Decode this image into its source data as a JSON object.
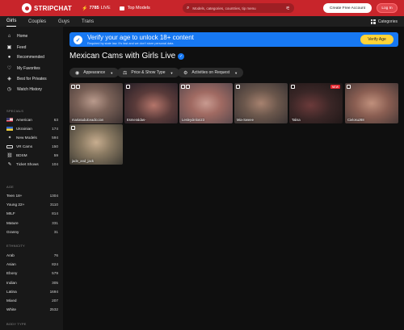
{
  "header": {
    "logo_text": "STRIPCHAT",
    "live_count": "7785",
    "live_label": "LIVE",
    "top_models_label": "Top Models",
    "search_placeholder": "Models, categories, countries, tip menu",
    "create_account_label": "Create Free Account",
    "login_label": "Log In",
    "colors": {
      "brand": "#c8252b",
      "accent": "#1778f2",
      "verify": "#ffd338"
    }
  },
  "tabs": [
    {
      "label": "Girls",
      "active": true
    },
    {
      "label": "Couples",
      "active": false
    },
    {
      "label": "Guys",
      "active": false
    },
    {
      "label": "Trans",
      "active": false
    }
  ],
  "categories_label": "Categories",
  "sidebar": {
    "nav": [
      {
        "label": "Home",
        "icon": "home-icon"
      },
      {
        "label": "Feed",
        "icon": "feed-icon"
      },
      {
        "label": "Recommended",
        "icon": "recommended-icon"
      },
      {
        "label": "My Favorites",
        "icon": "heart-icon"
      },
      {
        "label": "Best for Privates",
        "icon": "privates-icon"
      },
      {
        "label": "Watch History",
        "icon": "history-icon"
      }
    ],
    "specials_title": "SPECIALS",
    "specials": [
      {
        "label": "American",
        "count": "63",
        "icon": "us-flag-icon"
      },
      {
        "label": "Ukrainian",
        "count": "174",
        "icon": "ua-flag-icon"
      },
      {
        "label": "New Models",
        "count": "594",
        "icon": "new-icon"
      },
      {
        "label": "VR Cams",
        "count": "150",
        "icon": "vr-icon"
      },
      {
        "label": "BDSM",
        "count": "59",
        "icon": "bdsm-icon"
      },
      {
        "label": "Ticket Shows",
        "count": "104",
        "icon": "ticket-icon"
      }
    ],
    "age_title": "AGE",
    "age": [
      {
        "label": "Teen 18+",
        "count": "1304"
      },
      {
        "label": "Young 22+",
        "count": "3110"
      },
      {
        "label": "MILF",
        "count": "814"
      },
      {
        "label": "Mature",
        "count": "331"
      },
      {
        "label": "Granny",
        "count": "31"
      }
    ],
    "ethnicity_title": "ETHNICITY",
    "ethnicity": [
      {
        "label": "Arab",
        "count": "76"
      },
      {
        "label": "Asian",
        "count": "824"
      },
      {
        "label": "Ebony",
        "count": "579"
      },
      {
        "label": "Indian",
        "count": "305"
      },
      {
        "label": "Latina",
        "count": "1694"
      },
      {
        "label": "Mixed",
        "count": "207"
      },
      {
        "label": "White",
        "count": "2532"
      }
    ],
    "body_type_title": "BODY TYPE"
  },
  "banner": {
    "title": "Verify your age to unlock 18+ content",
    "subtitle": "Required by state law. It's fast and we don't store personal data.",
    "button_label": "Verify Age"
  },
  "page_title": "Mexican Cams with Girls Live",
  "filters": [
    {
      "label": "Appearance",
      "icon": "eye-icon"
    },
    {
      "label": "Price & Show Type",
      "icon": "price-icon"
    },
    {
      "label": "Activities on Request",
      "icon": "activities-icon"
    }
  ],
  "models": [
    {
      "name": "mariatudulceadiccion",
      "badge": ""
    },
    {
      "name": "Esmeraldas-",
      "badge": ""
    },
    {
      "name": "Lesleydelion23",
      "badge": ""
    },
    {
      "name": "Mia-Sweee",
      "badge": ""
    },
    {
      "name": "Talisa",
      "badge": "NEW"
    },
    {
      "name": "Cielosuz88",
      "badge": ""
    },
    {
      "name": "jade_and_jack",
      "badge": ""
    }
  ]
}
